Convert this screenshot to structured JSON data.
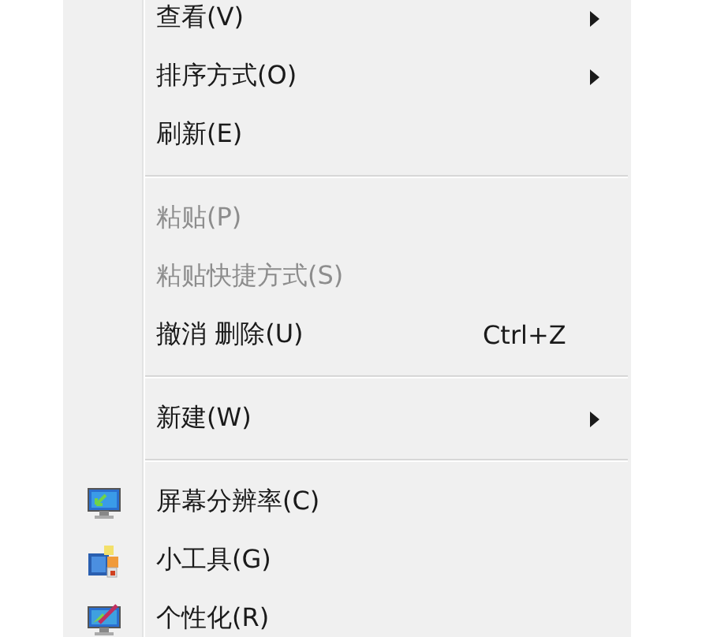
{
  "context_menu": {
    "items": [
      {
        "kind": "item",
        "label": "查看(V)",
        "disabled": false,
        "submenu": true
      },
      {
        "kind": "item",
        "label": "排序方式(O)",
        "disabled": false,
        "submenu": true
      },
      {
        "kind": "item",
        "label": "刷新(E)",
        "disabled": false,
        "submenu": false
      },
      {
        "kind": "separator"
      },
      {
        "kind": "item",
        "label": "粘贴(P)",
        "disabled": true,
        "submenu": false
      },
      {
        "kind": "item",
        "label": "粘贴快捷方式(S)",
        "disabled": true,
        "submenu": false
      },
      {
        "kind": "item",
        "label": "撤消 删除(U)",
        "disabled": false,
        "submenu": false,
        "shortcut": "Ctrl+Z"
      },
      {
        "kind": "separator"
      },
      {
        "kind": "item",
        "label": "新建(W)",
        "disabled": false,
        "submenu": true
      },
      {
        "kind": "separator"
      },
      {
        "kind": "display",
        "label": "屏幕分辨率(C)",
        "disabled": false,
        "submenu": false
      },
      {
        "kind": "gadgets",
        "label": "小工具(G)",
        "disabled": false,
        "submenu": false
      },
      {
        "kind": "personalize",
        "label": "个性化(R)",
        "disabled": false,
        "submenu": false
      }
    ]
  }
}
